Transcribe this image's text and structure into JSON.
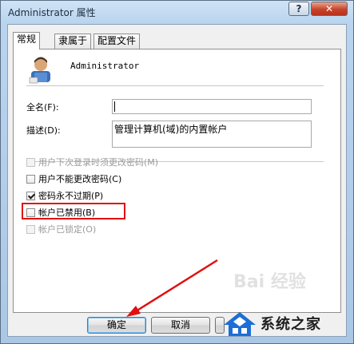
{
  "window": {
    "title": "Administrator 属性",
    "help_label": "?",
    "close_label": "✕"
  },
  "tabs": [
    {
      "label": "常规",
      "active": true
    },
    {
      "label": "隶属于",
      "active": false
    },
    {
      "label": "配置文件",
      "active": false
    }
  ],
  "user": {
    "name": "Administrator",
    "icon": "user-icon"
  },
  "form": {
    "fullname_label": "全名(F):",
    "fullname_value": "",
    "description_label": "描述(D):",
    "description_value": "管理计算机(域)的内置帐户"
  },
  "checkboxes": [
    {
      "label": "用户下次登录时须更改密码(M)",
      "checked": false,
      "disabled": true
    },
    {
      "label": "用户不能更改密码(C)",
      "checked": false,
      "disabled": false
    },
    {
      "label": "密码永不过期(P)",
      "checked": true,
      "disabled": false
    },
    {
      "label": "帐户已禁用(B)",
      "checked": false,
      "disabled": false
    },
    {
      "label": "帐户已锁定(O)",
      "checked": false,
      "disabled": true
    }
  ],
  "buttons": {
    "ok": "确定",
    "cancel": "取消"
  },
  "watermark": {
    "text": "系统之家",
    "baidu": "Bai 经验"
  },
  "colors": {
    "highlight_box": "#e01010",
    "arrow": "#e01010"
  }
}
